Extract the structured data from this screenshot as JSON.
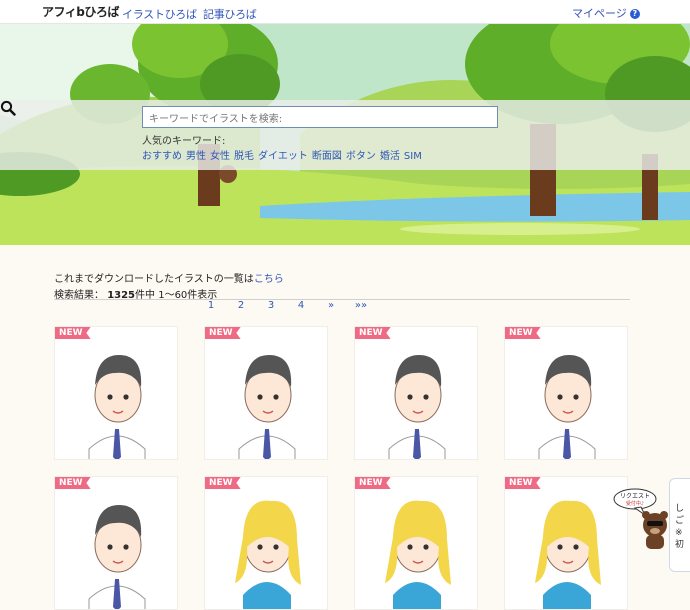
{
  "header": {
    "site_name": "アフィbひろば",
    "nav": [
      "イラストひろば",
      "記事ひろば"
    ],
    "mypage_label": "マイページ",
    "help_icon": "?"
  },
  "search": {
    "placeholder": "キーワードでイラストを検索:",
    "button_icon": "search-icon",
    "keywords_label": "人気のキーワード:",
    "keywords": [
      "おすすめ",
      "男性",
      "女性",
      "脱毛",
      "ダイエット",
      "断面図",
      "ボタン",
      "婚活",
      "SIM"
    ]
  },
  "results": {
    "download_text": "これまでダウンロードしたイラストの一覧は",
    "download_link": "こちら",
    "summary_label": "検索結果：",
    "total": "1325",
    "summary_suffix": "件中 1〜60件表示",
    "pages": [
      "1",
      "2",
      "3",
      "4",
      "»",
      "»»"
    ]
  },
  "cards": [
    {
      "badge": "NEW",
      "subject": "man-dark-hair-surprised"
    },
    {
      "badge": "NEW",
      "subject": "man-dark-hair-happy"
    },
    {
      "badge": "NEW",
      "subject": "man-dark-hair-thinking"
    },
    {
      "badge": "NEW",
      "subject": "man-dark-hair-tired"
    },
    {
      "badge": "NEW",
      "subject": "man-dark-hair-worried"
    },
    {
      "badge": "NEW",
      "subject": "woman-blonde-shocked"
    },
    {
      "badge": "NEW",
      "subject": "woman-blonde-happy"
    },
    {
      "badge": "NEW",
      "subject": "woman-blonde-wink"
    }
  ],
  "request_widget": {
    "bubble_line1": "リクエスト",
    "bubble_line2": "受付中♪"
  },
  "side_tab_text": [
    "し",
    "ご",
    "※",
    "初"
  ],
  "colors": {
    "link": "#3355bb",
    "badge": "#ef6b85",
    "sky": "#bfe6c8",
    "grass": "#b6dd4a"
  }
}
